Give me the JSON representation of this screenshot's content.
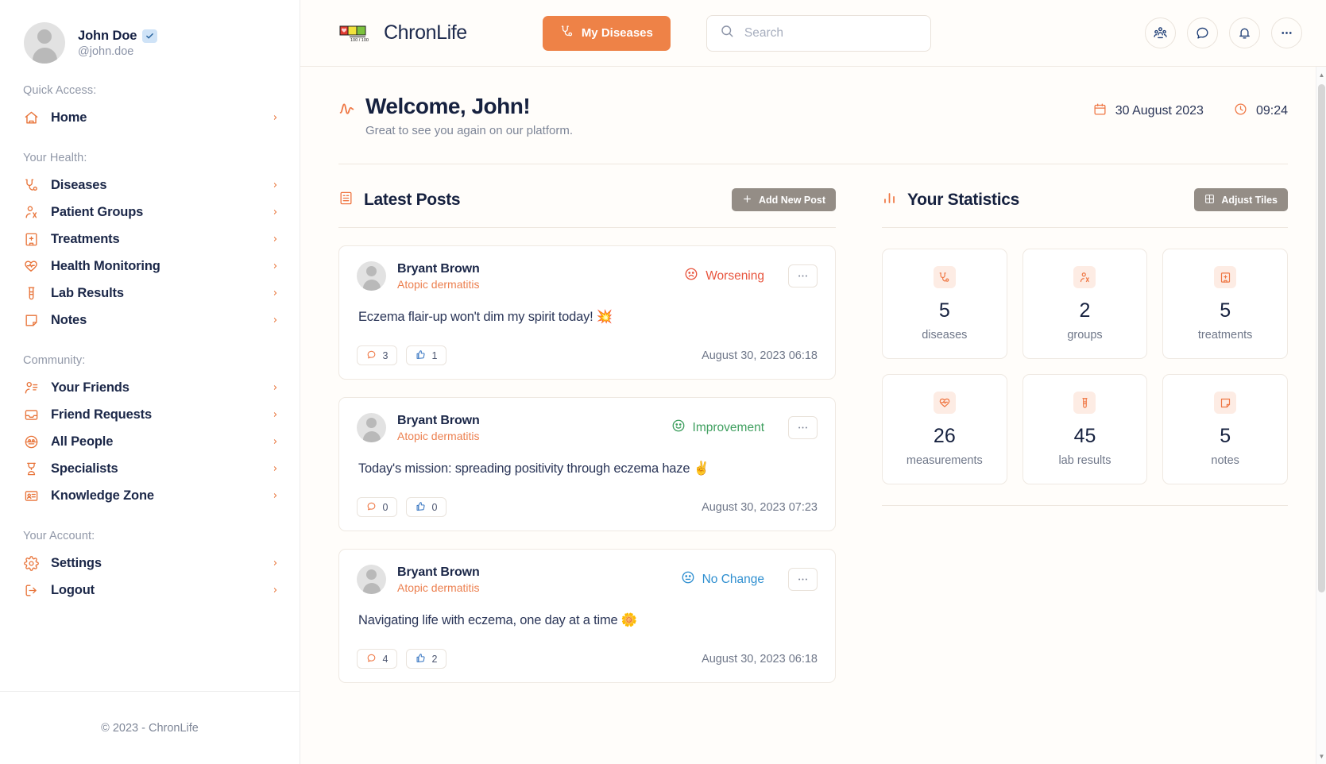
{
  "profile": {
    "name": "John Doe",
    "handle": "@john.doe",
    "verified_icon": "check-badge-icon"
  },
  "sidebar": {
    "groups": [
      {
        "heading": "Quick Access:",
        "items": [
          {
            "label": "Home",
            "icon": "home-icon"
          }
        ]
      },
      {
        "heading": "Your Health:",
        "items": [
          {
            "label": "Diseases",
            "icon": "stethoscope-icon"
          },
          {
            "label": "Patient Groups",
            "icon": "user-group-icon"
          },
          {
            "label": "Treatments",
            "icon": "hospital-icon"
          },
          {
            "label": "Health Monitoring",
            "icon": "heart-pulse-icon"
          },
          {
            "label": "Lab Results",
            "icon": "test-tube-icon"
          },
          {
            "label": "Notes",
            "icon": "note-icon"
          }
        ]
      },
      {
        "heading": "Community:",
        "items": [
          {
            "label": "Your Friends",
            "icon": "user-list-icon"
          },
          {
            "label": "Friend Requests",
            "icon": "inbox-icon"
          },
          {
            "label": "All People",
            "icon": "globe-users-icon"
          },
          {
            "label": "Specialists",
            "icon": "doctor-icon"
          },
          {
            "label": "Knowledge Zone",
            "icon": "id-card-icon"
          }
        ]
      },
      {
        "heading": "Your Account:",
        "items": [
          {
            "label": "Settings",
            "icon": "gear-icon"
          },
          {
            "label": "Logout",
            "icon": "logout-icon"
          }
        ]
      }
    ],
    "footer": "© 2023 - ChronLife"
  },
  "topbar": {
    "brand": "ChronLife",
    "logo_icon": "health-bar-logo-icon",
    "logo_value": "100 / 100",
    "my_diseases_label": "My Diseases",
    "my_diseases_icon": "stethoscope-icon",
    "search": {
      "placeholder": "Search",
      "value": "",
      "icon": "search-icon"
    },
    "icons": [
      {
        "name": "people-icon"
      },
      {
        "name": "chat-bubble-icon"
      },
      {
        "name": "bell-icon"
      },
      {
        "name": "more-horizontal-icon"
      }
    ]
  },
  "welcome": {
    "icon": "activity-pulse-icon",
    "title": "Welcome, John!",
    "subtitle": "Great to see you again on our platform.",
    "date": "30 August 2023",
    "date_icon": "calendar-icon",
    "time": "09:24",
    "time_icon": "clock-icon"
  },
  "posts_section": {
    "title": "Latest Posts",
    "title_icon": "article-icon",
    "add_button_label": "Add New Post",
    "add_button_icon": "plus-icon",
    "posts": [
      {
        "author": "Bryant Brown",
        "disease": "Atopic dermatitis",
        "status": "Worsening",
        "status_icon": "frowning-face-icon",
        "status_color": "#e8553e",
        "body": "Eczema flair-up won't dim my spirit today! 💥",
        "comments": "3",
        "likes": "1",
        "timestamp": "August 30, 2023 06:18",
        "menu_icon": "more-horizontal-icon"
      },
      {
        "author": "Bryant Brown",
        "disease": "Atopic dermatitis",
        "status": "Improvement",
        "status_icon": "smiling-face-icon",
        "status_color": "#3f9f5f",
        "body": "Today's mission: spreading positivity through eczema haze ✌️",
        "comments": "0",
        "likes": "0",
        "timestamp": "August 30, 2023 07:23",
        "menu_icon": "more-horizontal-icon"
      },
      {
        "author": "Bryant Brown",
        "disease": "Atopic dermatitis",
        "status": "No Change",
        "status_icon": "neutral-face-icon",
        "status_color": "#2f8fd0",
        "body": "Navigating life with eczema, one day at a time 🌼",
        "comments": "4",
        "likes": "2",
        "timestamp": "August 30, 2023 06:18",
        "menu_icon": "more-horizontal-icon"
      }
    ]
  },
  "stats_section": {
    "title": "Your Statistics",
    "title_icon": "bar-chart-icon",
    "adjust_button_label": "Adjust Tiles",
    "adjust_button_icon": "grid-icon",
    "tiles": [
      {
        "value": "5",
        "label": "diseases",
        "icon": "stethoscope-icon"
      },
      {
        "value": "2",
        "label": "groups",
        "icon": "user-group-icon"
      },
      {
        "value": "5",
        "label": "treatments",
        "icon": "hospital-icon"
      },
      {
        "value": "26",
        "label": "measurements",
        "icon": "heart-pulse-icon"
      },
      {
        "value": "45",
        "label": "lab results",
        "icon": "test-tube-icon"
      },
      {
        "value": "5",
        "label": "notes",
        "icon": "note-icon"
      }
    ]
  },
  "colors": {
    "accent": "#ee8247",
    "navy": "#16213f",
    "muted": "#7d8597",
    "grey_button": "#948d86",
    "page_bg": "#fffdfa"
  }
}
